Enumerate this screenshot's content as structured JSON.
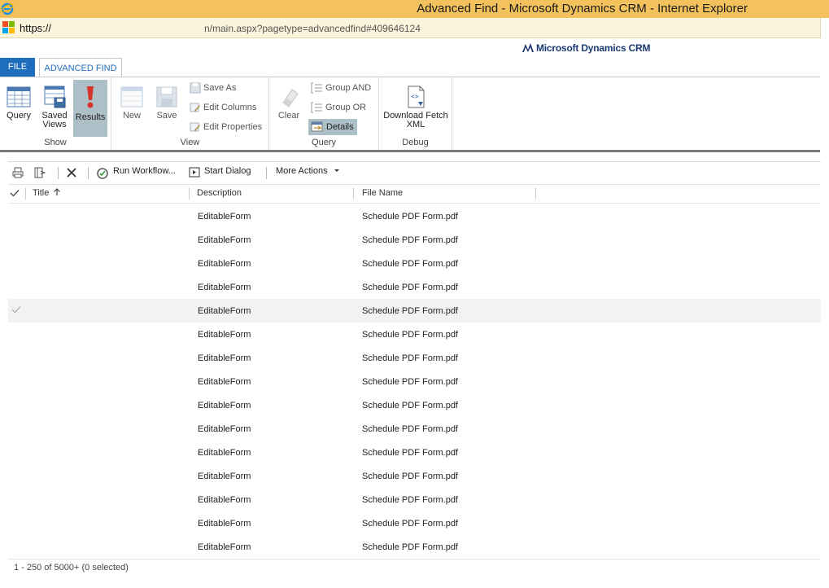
{
  "window": {
    "title": "Advanced Find - Microsoft Dynamics CRM - Internet Explorer"
  },
  "address": {
    "protocol": "https://",
    "path": "n/main.aspx?pagetype=advancedfind#409646124"
  },
  "brand": {
    "logo_text": "Microsoft Dynamics CRM"
  },
  "tabs": [
    {
      "label": "FILE"
    },
    {
      "label": "ADVANCED FIND"
    }
  ],
  "ribbon": {
    "show": {
      "label": "Show",
      "query": "Query",
      "saved_views_1": "Saved",
      "saved_views_2": "Views",
      "results": "Results"
    },
    "view": {
      "label": "View",
      "new": "New",
      "save": "Save",
      "save_as": "Save As",
      "edit_columns": "Edit Columns",
      "edit_properties": "Edit Properties"
    },
    "query": {
      "label": "Query",
      "clear": "Clear",
      "group_and": "Group AND",
      "group_or": "Group OR",
      "details": "Details"
    },
    "debug": {
      "label": "Debug",
      "download_1": "Download Fetch",
      "download_2": "XML"
    }
  },
  "toolbar": {
    "run_workflow": "Run Workflow...",
    "start_dialog": "Start Dialog",
    "more_actions": "More Actions"
  },
  "grid": {
    "columns": {
      "title": "Title",
      "description": "Description",
      "file_name": "File Name"
    },
    "rows": [
      {
        "description": "EditableForm",
        "file_name": "Schedule PDF Form.pdf"
      },
      {
        "description": "EditableForm",
        "file_name": "Schedule PDF Form.pdf"
      },
      {
        "description": "EditableForm",
        "file_name": "Schedule PDF Form.pdf"
      },
      {
        "description": "EditableForm",
        "file_name": "Schedule PDF Form.pdf"
      },
      {
        "description": "EditableForm",
        "file_name": "Schedule PDF Form.pdf",
        "highlight": true
      },
      {
        "description": "EditableForm",
        "file_name": "Schedule PDF Form.pdf"
      },
      {
        "description": "EditableForm",
        "file_name": "Schedule PDF Form.pdf"
      },
      {
        "description": "EditableForm",
        "file_name": "Schedule PDF Form.pdf"
      },
      {
        "description": "EditableForm",
        "file_name": "Schedule PDF Form.pdf"
      },
      {
        "description": "EditableForm",
        "file_name": "Schedule PDF Form.pdf"
      },
      {
        "description": "EditableForm",
        "file_name": "Schedule PDF Form.pdf"
      },
      {
        "description": "EditableForm",
        "file_name": "Schedule PDF Form.pdf"
      },
      {
        "description": "EditableForm",
        "file_name": "Schedule PDF Form.pdf"
      },
      {
        "description": "EditableForm",
        "file_name": "Schedule PDF Form.pdf"
      },
      {
        "description": "EditableForm",
        "file_name": "Schedule PDF Form.pdf"
      }
    ],
    "status": "1 - 250 of 5000+ (0 selected)"
  },
  "colors": {
    "file_tab": "#1f6dbd",
    "titlebar": "#f3c25d",
    "active_button": "#adbfc7"
  }
}
